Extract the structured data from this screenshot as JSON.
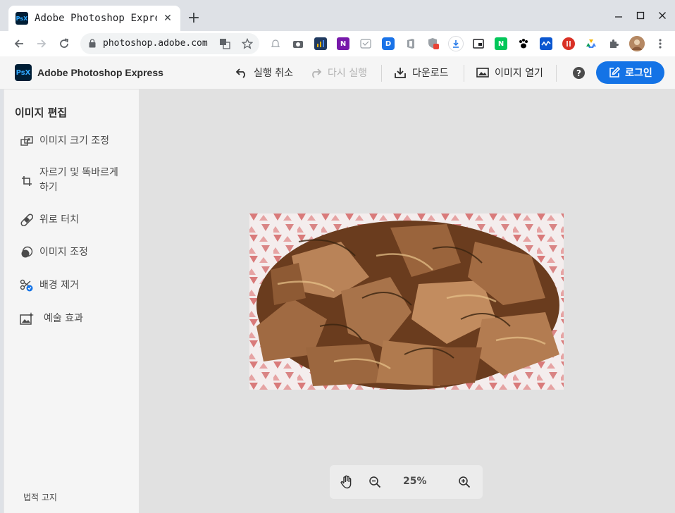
{
  "browser": {
    "tab_title": "Adobe Photoshop Express",
    "favicon_text": "PsX",
    "url": "photoshop.adobe.com",
    "extensions": [
      "bell-icon",
      "camera-icon",
      "chart-extension",
      "onenote-extension",
      "clipboard-extension",
      "d-extension",
      "office-extension",
      "shield-extension",
      "download-extension",
      "pip-extension",
      "naver-extension",
      "paw-extension",
      "wave-extension",
      "red-extension",
      "drive-extension",
      "puzzle-icon",
      "profile-avatar"
    ],
    "ext_labels": {
      "onenote": "N",
      "d": "D",
      "naver": "N"
    }
  },
  "app": {
    "logo_text": "PsX",
    "name": "Adobe Photoshop Express",
    "undo_label": "실행 취소",
    "redo_label": "다시 실행",
    "download_label": "다운로드",
    "open_image_label": "이미지 열기",
    "help_label": "?",
    "login_label": "로그인"
  },
  "panel": {
    "title": "이미지 편집",
    "tools": [
      {
        "label": "이미지 크기 조정",
        "icon": "resize-icon"
      },
      {
        "label": "자르기 및 똑바르게 하기",
        "icon": "crop-icon"
      },
      {
        "label": "위로 터치",
        "icon": "bandage-icon"
      },
      {
        "label": "이미지 조정",
        "icon": "adjust-icon"
      },
      {
        "label": "배경 제거",
        "icon": "scissors-icon"
      },
      {
        "label": "예술 효과",
        "icon": "magic-image-icon"
      }
    ],
    "legal": "법적 고지"
  },
  "canvas": {
    "image_desc": "photo",
    "zoom": "25%"
  },
  "colors": {
    "accent": "#1473e6",
    "panel_bg": "#f5f5f5",
    "canvas_bg": "#e1e1e1",
    "logo_bg": "#001e36"
  }
}
